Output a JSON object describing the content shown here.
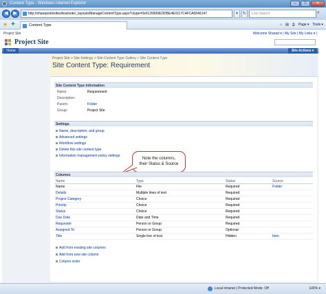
{
  "window": {
    "title": "Content Type - Windows Internet Explorer",
    "min_label": "–",
    "max_label": "□",
    "close_label": "✕"
  },
  "addressbar": {
    "url": "http://sharepoint/sites/teamsite/_layouts/ManageContentType.aspx?ctype=0x0120000EDDBE4E0117C4FCA5546147",
    "search_placeholder": "Live Search"
  },
  "tab": {
    "label": "Content Type"
  },
  "commandbar": {
    "home": "⌂",
    "feeds": "▤",
    "print": "⎙",
    "page": "Page ▾",
    "tools": "Tools ▾"
  },
  "sharepoint": {
    "site_link": "Project Site",
    "welcome": "Welcome Sharad ▾  |  My Site  |  My Links ▾  |",
    "site_title": "Project Site",
    "nav_home": "Home",
    "site_actions": "Site Actions ▾"
  },
  "page": {
    "breadcrumb": "Project Site > Site Settings > Site Content Type Gallery > Site Content Type",
    "title": "Site Content Type: Requirement"
  },
  "info": {
    "heading": "Site Content Type Information",
    "rows": [
      {
        "key": "Name:",
        "value": "Requirement",
        "link": false
      },
      {
        "key": "Description:",
        "value": "",
        "link": false
      },
      {
        "key": "Parent:",
        "value": "Folder",
        "link": true
      },
      {
        "key": "Group:",
        "value": "Project Site",
        "link": false
      }
    ]
  },
  "settings": {
    "heading": "Settings",
    "links": [
      "Name, description, and group",
      "Advanced settings",
      "Workflow settings",
      "Delete this site content type",
      "Information management policy settings"
    ]
  },
  "callout": {
    "line1": "Note the columns,",
    "line2": "their Status & Source"
  },
  "columns": {
    "heading": "Columns",
    "headers": {
      "name": "Name",
      "type": "Type",
      "status": "Status",
      "source": "Source"
    },
    "rows": [
      {
        "name": "Name",
        "type": "File",
        "status": "Required",
        "source": "Folder",
        "name_link": false
      },
      {
        "name": "Details",
        "type": "Multiple lines of text",
        "status": "Required",
        "source": "",
        "name_link": true
      },
      {
        "name": "Project Category",
        "type": "Choice",
        "status": "Required",
        "source": "",
        "name_link": true
      },
      {
        "name": "Priority",
        "type": "Choice",
        "status": "Required",
        "source": "",
        "name_link": true
      },
      {
        "name": "Status",
        "type": "Choice",
        "status": "Required",
        "source": "",
        "name_link": true
      },
      {
        "name": "Due Date",
        "type": "Date and Time",
        "status": "Required",
        "source": "",
        "name_link": true
      },
      {
        "name": "Requester",
        "type": "Person or Group",
        "status": "Required",
        "source": "",
        "name_link": true
      },
      {
        "name": "Assigned To",
        "type": "Person or Group",
        "status": "Optional",
        "source": "",
        "name_link": true
      },
      {
        "name": "Title",
        "type": "Single line of text",
        "status": "Hidden",
        "source": "Item",
        "name_link": true
      }
    ],
    "footer_links": [
      "Add from existing site columns",
      "Add from new site column",
      "Column order"
    ]
  },
  "statusbar": {
    "zone": "Local intranet | Protected Mode: Off",
    "zoom": "100% ▾"
  },
  "colors": {
    "link": "#003399",
    "title": "#223a66",
    "callout_border": "#c0392b"
  }
}
